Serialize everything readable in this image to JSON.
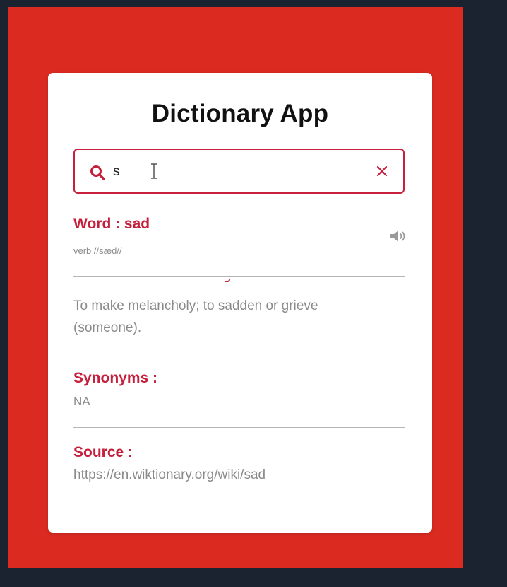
{
  "app": {
    "title": "Dictionary App"
  },
  "search": {
    "value": "s",
    "placeholder": ""
  },
  "result": {
    "word_label": "Word : sad",
    "phonetic": "verb //sæd//",
    "meaning": "To make melancholy; to sadden or grieve (someone).",
    "synonyms_label": "Synonyms :",
    "synonyms_value": "NA",
    "source_label": "Source :",
    "source_url": "https://en.wiktionary.org/wiki/sad"
  },
  "icons": {
    "search": "search-icon",
    "clear": "close-icon",
    "speaker": "speaker-icon",
    "cursor": "text-cursor-icon"
  },
  "colors": {
    "background": "#1b2330",
    "panel": "#db2b21",
    "accent": "#c51f3b",
    "muted_text": "#8a8a8a"
  }
}
